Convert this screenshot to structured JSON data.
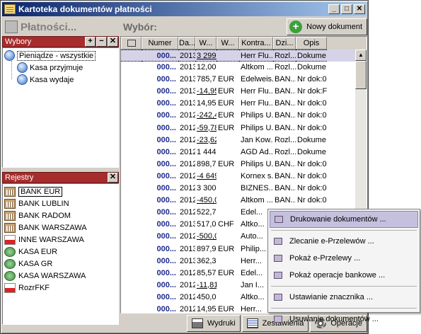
{
  "window": {
    "title": "Kartoteka dokumentów płatności"
  },
  "left": {
    "header": "Płatności...",
    "choices_bar": "Wybory",
    "tree": {
      "root": "Pieniądze - wszystkie",
      "children": [
        "Kasa przyjmuje",
        "Kasa wydaje"
      ]
    },
    "registers_bar": "Rejestry",
    "registers": [
      {
        "label": "BANK EUR",
        "icon": "bank-icon"
      },
      {
        "label": "BANK LUBLIN",
        "icon": "bank-icon"
      },
      {
        "label": "BANK RADOM",
        "icon": "bank-icon"
      },
      {
        "label": "BANK WARSZAWA",
        "icon": "bank-icon"
      },
      {
        "label": "INNE WARSZAWA",
        "icon": "flag-icon"
      },
      {
        "label": "KASA EUR",
        "icon": "cash-icon"
      },
      {
        "label": "KASA GR",
        "icon": "cash-icon"
      },
      {
        "label": "KASA WARSZAWA",
        "icon": "cash-icon"
      },
      {
        "label": "RozrFKF",
        "icon": "flag-icon"
      }
    ]
  },
  "right": {
    "title": "Wybór:",
    "new_doc": "Nowy dokument",
    "columns": [
      "Numer",
      "Da...",
      "W...",
      "W...",
      "Kontra...",
      "Dzi...",
      "Opis"
    ],
    "rows": [
      [
        "000...",
        "2013...",
        "3 299,9",
        "",
        "Herr Flu...",
        "Rozl...",
        "Dokume..."
      ],
      [
        "000...",
        "2013...",
        "12,00",
        "",
        "Altkom ...",
        "Rozl...",
        "Dokume..."
      ],
      [
        "000...",
        "2013...",
        "785,70",
        "EUR",
        "Edelweis...",
        "BAN...",
        "Nr dok:0..."
      ],
      [
        "000...",
        "2013...",
        "-14,95",
        "EUR",
        "Herr Flu...",
        "BAN...",
        "Nr dok:F..."
      ],
      [
        "000...",
        "2013...",
        "14,95",
        "EUR",
        "Herr Flu...",
        "BAN...",
        "Nr dok:0..."
      ],
      [
        "000...",
        "2012...",
        "-242,49",
        "EUR",
        "Philips U...",
        "BAN...",
        "Nr dok:0..."
      ],
      [
        "000...",
        "2012...",
        "-59,78",
        "EUR",
        "Philips U...",
        "BAN...",
        "Nr dok:0..."
      ],
      [
        "000...",
        "2012...",
        "-23,62",
        "",
        "Jan Kow...",
        "Rozl...",
        "Dokume..."
      ],
      [
        "000...",
        "2012...",
        "1 444,2",
        "",
        "AGD Ad...",
        "Rozl...",
        "Dokume..."
      ],
      [
        "000...",
        "2012...",
        "898,76",
        "EUR",
        "Philips U...",
        "BAN...",
        "Nr dok:0..."
      ],
      [
        "000...",
        "2012...",
        "-4 649,",
        "",
        "Kornex s...",
        "BAN...",
        "Nr dok:0..."
      ],
      [
        "000...",
        "2012...",
        "3 300,0",
        "",
        "BIZNES...",
        "BAN...",
        "Nr dok:0..."
      ],
      [
        "000...",
        "2012...",
        "-450,00",
        "",
        "Altkom ...",
        "BAN...",
        "Nr dok:0..."
      ],
      [
        "000...",
        "2012...",
        "522,73",
        "",
        "Edel...",
        "",
        ""
      ],
      [
        "000...",
        "2013...",
        "517,02",
        "CHF",
        "Altko...",
        "",
        ""
      ],
      [
        "000...",
        "2012...",
        "-500,00",
        "",
        "Auto...",
        "",
        ""
      ],
      [
        "000...",
        "2013...",
        "897,90",
        "EUR",
        "Philip...",
        "",
        ""
      ],
      [
        "000...",
        "2013...",
        "362,30",
        "",
        "Herr...",
        "",
        ""
      ],
      [
        "000...",
        "2012...",
        "85,57",
        "EUR",
        "Edel...",
        "",
        ""
      ],
      [
        "000...",
        "2012...",
        "-11,81",
        "",
        "Jan I...",
        "",
        ""
      ],
      [
        "000...",
        "2012...",
        "450,00",
        "",
        "Altko...",
        "",
        ""
      ],
      [
        "000...",
        "2012...",
        "14,95",
        "EUR",
        "Herr...",
        "",
        ""
      ]
    ],
    "underlined_rows": [
      0,
      3,
      5,
      6,
      7,
      10,
      12,
      15,
      19
    ],
    "bottom": {
      "print": "Wydruki",
      "reports": "Zestawienia",
      "ops": "Operacje"
    }
  },
  "context_menu": {
    "items": [
      "Drukowanie dokumentów ...",
      "Zlecanie e-Przelewów ...",
      "Pokaż e-Przelewy ...",
      "Pokaż operacje bankowe ...",
      "Ustawianie znacznika ...",
      "Usuwanie dokumentów ..."
    ]
  }
}
